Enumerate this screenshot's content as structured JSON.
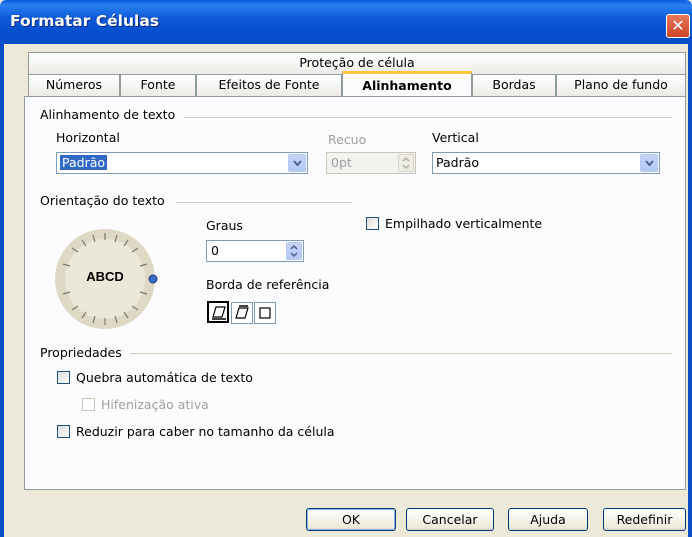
{
  "window": {
    "title": "Formatar Células",
    "close_glyph": "✕"
  },
  "tabs_top": [
    {
      "label": "Proteção de célula"
    }
  ],
  "tabs": [
    {
      "label": "Números"
    },
    {
      "label": "Fonte"
    },
    {
      "label": "Efeitos de Fonte"
    },
    {
      "label": "Alinhamento",
      "active": true
    },
    {
      "label": "Bordas"
    },
    {
      "label": "Plano de fundo"
    }
  ],
  "text_alignment": {
    "group_label": "Alinhamento de texto",
    "horizontal_label": "Horizontal",
    "horizontal_value": "Padrão",
    "indent_label": "Recuo",
    "indent_value": "0pt",
    "vertical_label": "Vertical",
    "vertical_value": "Padrão"
  },
  "orientation": {
    "group_label": "Orientação do texto",
    "dial_text": "ABCD",
    "degrees_label": "Graus",
    "degrees_value": "0",
    "reference_label": "Borda de referência",
    "stacked_label": "Empilhado verticalmente"
  },
  "properties": {
    "group_label": "Propriedades",
    "wrap_label": "Quebra automática de texto",
    "hyphen_label": "Hifenização ativa",
    "shrink_label": "Reduzir para caber no tamanho da célula"
  },
  "buttons": {
    "ok": "OK",
    "cancel": "Cancelar",
    "help": "Ajuda",
    "reset": "Redefinir"
  },
  "colors": {
    "titlebar": "#0a5be0",
    "selection": "#316ac5",
    "active_tab_accent": "#ffc83c"
  }
}
